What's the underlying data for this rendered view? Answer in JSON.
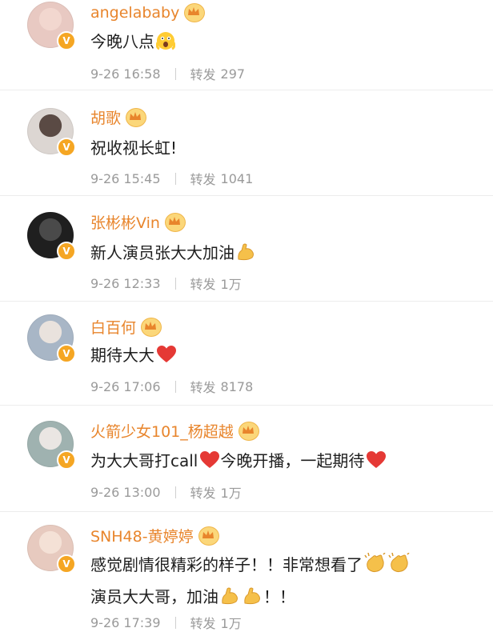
{
  "verified_badge": "V",
  "repost_label": "转发",
  "comments": [
    {
      "name": "angelababy",
      "text_parts": [
        "今晚八点"
      ],
      "time": "9-26 16:58",
      "reposts": "297",
      "avatar_colors": [
        "#f2d7cf",
        "#e8c9c2"
      ]
    },
    {
      "name": "胡歌",
      "text_parts": [
        "祝收视长虹!"
      ],
      "time": "9-26 15:45",
      "reposts": "1041",
      "avatar_colors": [
        "#5a4a44",
        "#dcd6d2"
      ]
    },
    {
      "name": "张彬彬Vin",
      "text_parts": [
        "新人演员张大大加油"
      ],
      "time": "9-26 12:33",
      "reposts": "1万",
      "avatar_colors": [
        "#4a4a4a",
        "#1f1f1f"
      ]
    },
    {
      "name": "白百何",
      "text_parts": [
        "期待大大"
      ],
      "time": "9-26 17:06",
      "reposts": "8178",
      "avatar_colors": [
        "#e9e2dd",
        "#a8b6c6"
      ]
    },
    {
      "name": "火箭少女101_杨超越",
      "text_parts": [
        "为大大哥打call",
        "今晚开播，一起期待"
      ],
      "time": "9-26 13:00",
      "reposts": "1万",
      "avatar_colors": [
        "#eae6e3",
        "#9fb2b0"
      ]
    },
    {
      "name": "SNH48-黄婷婷",
      "text_parts": [
        "感觉剧情很精彩的样子！！非常想看了",
        "演员大大哥，加油",
        "！！"
      ],
      "time": "9-26 17:39",
      "reposts": "1万",
      "avatar_colors": [
        "#f4e1d6",
        "#e7cabf"
      ]
    }
  ],
  "colors": {
    "name": "#e8852c",
    "badge": "#f5a623",
    "heart": "#e53935"
  }
}
